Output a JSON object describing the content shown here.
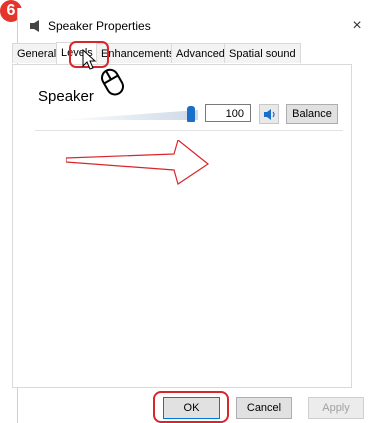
{
  "step_badge": "6",
  "window": {
    "title": "Speaker Properties",
    "close_glyph": "×"
  },
  "tabs": [
    {
      "label": "General"
    },
    {
      "label": "Levels"
    },
    {
      "label": "Enhancements"
    },
    {
      "label": "Advanced"
    },
    {
      "label": "Spatial sound"
    }
  ],
  "levels": {
    "section_label": "Speaker",
    "volume_value": "100",
    "volume_fraction": 1.0,
    "mute_icon": "speaker-icon",
    "balance_label": "Balance"
  },
  "footer": {
    "ok_label": "OK",
    "cancel_label": "Cancel",
    "apply_label": "Apply"
  },
  "colors": {
    "annotation_red": "#d9262c",
    "slider_blue": "#1a70c8"
  }
}
